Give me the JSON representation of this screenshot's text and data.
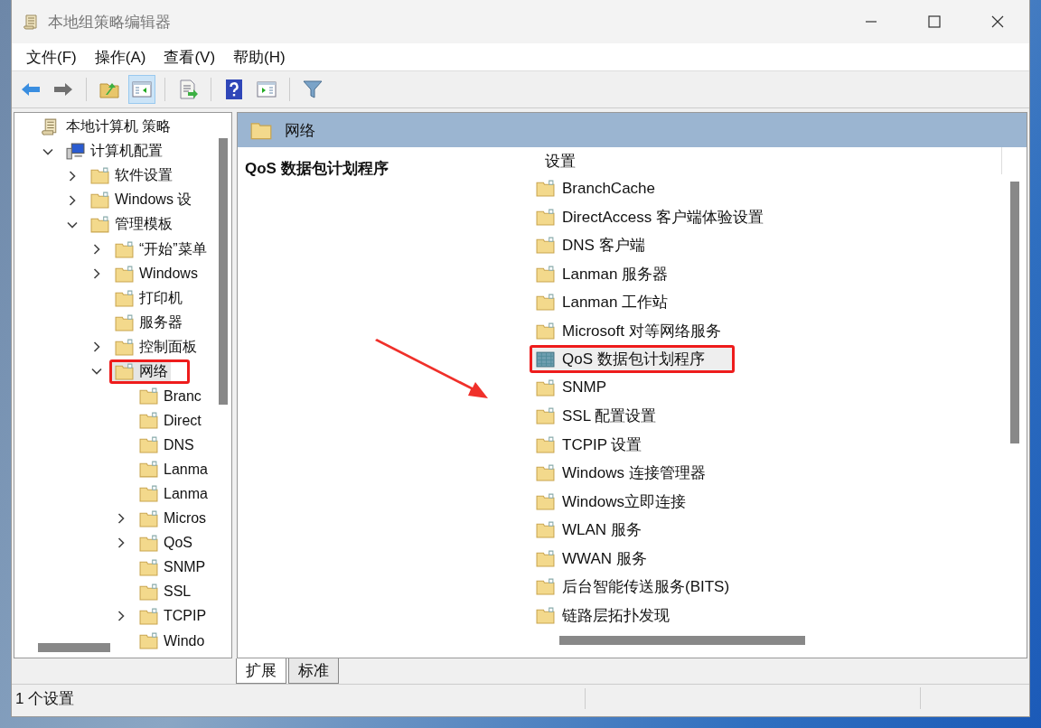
{
  "window": {
    "title": "本地组策略编辑器"
  },
  "menu": [
    "文件(F)",
    "操作(A)",
    "查看(V)",
    "帮助(H)"
  ],
  "toolbar": [
    {
      "kind": "back",
      "disabled": false,
      "pressed": false
    },
    {
      "kind": "forward",
      "disabled": true,
      "pressed": false
    },
    {
      "kind": "up",
      "disabled": false,
      "pressed": false
    },
    {
      "kind": "tree",
      "disabled": false,
      "pressed": true
    },
    {
      "kind": "export",
      "disabled": false,
      "pressed": false
    },
    {
      "kind": "help",
      "disabled": false,
      "pressed": false
    },
    {
      "kind": "actions",
      "disabled": false,
      "pressed": false
    },
    {
      "kind": "filter",
      "disabled": false,
      "pressed": false
    }
  ],
  "tree": [
    {
      "label": "本地计算机 策略",
      "kind": "policy",
      "has_children": false,
      "expanded": false,
      "selected": false,
      "children": [
        {
          "label": "计算机配置",
          "kind": "computer",
          "has_children": true,
          "expanded": true,
          "selected": false,
          "children": [
            {
              "label": "软件设置",
              "kind": "folder",
              "has_children": true,
              "expanded": false,
              "selected": false
            },
            {
              "label": "Windows 设",
              "kind": "folder",
              "has_children": true,
              "expanded": false,
              "selected": false
            },
            {
              "label": "管理模板",
              "kind": "folder",
              "has_children": true,
              "expanded": true,
              "selected": false,
              "children": [
                {
                  "label": "“开始”菜单",
                  "kind": "folder",
                  "has_children": true,
                  "expanded": false,
                  "selected": false
                },
                {
                  "label": "Windows",
                  "kind": "folder",
                  "has_children": true,
                  "expanded": false,
                  "selected": false
                },
                {
                  "label": "打印机",
                  "kind": "folder",
                  "has_children": false,
                  "expanded": false,
                  "selected": false
                },
                {
                  "label": "服务器",
                  "kind": "folder",
                  "has_children": false,
                  "expanded": false,
                  "selected": false
                },
                {
                  "label": "控制面板",
                  "kind": "folder",
                  "has_children": true,
                  "expanded": false,
                  "selected": false
                },
                {
                  "label": "网络",
                  "kind": "folder",
                  "has_children": true,
                  "expanded": true,
                  "selected": true,
                  "children": [
                    {
                      "label": "Branc",
                      "kind": "folder",
                      "has_children": false,
                      "expanded": false,
                      "selected": false
                    },
                    {
                      "label": "Direct",
                      "kind": "folder",
                      "has_children": false,
                      "expanded": false,
                      "selected": false
                    },
                    {
                      "label": "DNS",
                      "kind": "folder",
                      "has_children": false,
                      "expanded": false,
                      "selected": false
                    },
                    {
                      "label": "Lanma",
                      "kind": "folder",
                      "has_children": false,
                      "expanded": false,
                      "selected": false
                    },
                    {
                      "label": "Lanma",
                      "kind": "folder",
                      "has_children": false,
                      "expanded": false,
                      "selected": false
                    },
                    {
                      "label": "Micros",
                      "kind": "folder",
                      "has_children": true,
                      "expanded": false,
                      "selected": false
                    },
                    {
                      "label": "QoS",
                      "kind": "folder",
                      "has_children": true,
                      "expanded": false,
                      "selected": false
                    },
                    {
                      "label": "SNMP",
                      "kind": "folder",
                      "has_children": false,
                      "expanded": false,
                      "selected": false
                    },
                    {
                      "label": "SSL",
                      "kind": "folder",
                      "has_children": false,
                      "expanded": false,
                      "selected": false
                    },
                    {
                      "label": "TCPIP",
                      "kind": "folder",
                      "has_children": true,
                      "expanded": false,
                      "selected": false
                    },
                    {
                      "label": "Windo",
                      "kind": "folder",
                      "has_children": false,
                      "expanded": false,
                      "selected": false
                    }
                  ]
                }
              ]
            }
          ]
        }
      ]
    }
  ],
  "details": {
    "header": "网络",
    "description_title": "QoS 数据包计划程序",
    "column": "设置",
    "items": [
      {
        "label": "BranchCache",
        "kind": "folder",
        "selected": false
      },
      {
        "label": "DirectAccess 客户端体验设置",
        "kind": "folder",
        "selected": false
      },
      {
        "label": "DNS 客户端",
        "kind": "folder",
        "selected": false
      },
      {
        "label": "Lanman 服务器",
        "kind": "folder",
        "selected": false
      },
      {
        "label": "Lanman 工作站",
        "kind": "folder",
        "selected": false
      },
      {
        "label": "Microsoft 对等网络服务",
        "kind": "folder",
        "selected": false
      },
      {
        "label": "QoS 数据包计划程序",
        "kind": "settings",
        "selected": true
      },
      {
        "label": "SNMP",
        "kind": "folder",
        "selected": false
      },
      {
        "label": "SSL 配置设置",
        "kind": "folder",
        "selected": false
      },
      {
        "label": "TCPIP 设置",
        "kind": "folder",
        "selected": false
      },
      {
        "label": "Windows 连接管理器",
        "kind": "folder",
        "selected": false
      },
      {
        "label": "Windows立即连接",
        "kind": "folder",
        "selected": false
      },
      {
        "label": "WLAN 服务",
        "kind": "folder",
        "selected": false
      },
      {
        "label": "WWAN 服务",
        "kind": "folder",
        "selected": false
      },
      {
        "label": "后台智能传送服务(BITS)",
        "kind": "folder",
        "selected": false
      },
      {
        "label": "链路层拓扑发现",
        "kind": "folder",
        "selected": false
      }
    ]
  },
  "tabs": [
    {
      "label": "扩展",
      "selected": true
    },
    {
      "label": "标准",
      "selected": false
    }
  ],
  "status_bar": "1 个设置"
}
